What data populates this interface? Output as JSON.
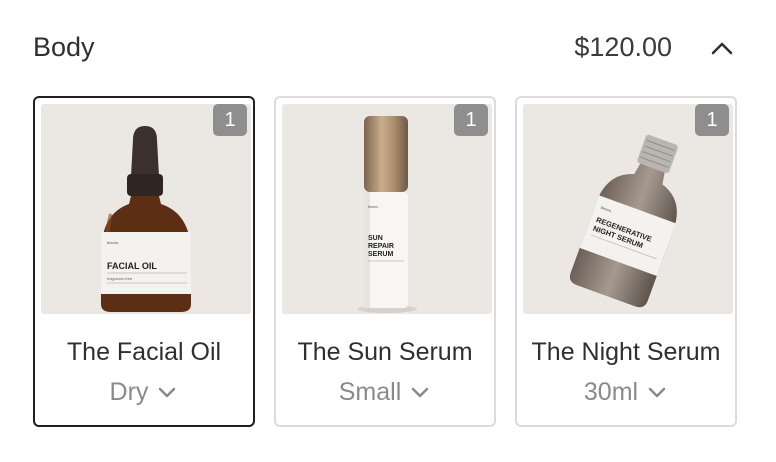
{
  "section": {
    "title": "Body",
    "subtotal": "$120.00",
    "toggle_icon": "chevron-up-icon"
  },
  "products": [
    {
      "name": "The Facial Oil",
      "variant": "Dry",
      "quantity": "1",
      "selected": true,
      "label": "FACIAL OIL"
    },
    {
      "name": "The Sun Serum",
      "variant": "Small",
      "quantity": "1",
      "selected": false,
      "label": "SUN REPAIR SERUM"
    },
    {
      "name": "The Night Serum",
      "variant": "30ml",
      "quantity": "1",
      "selected": false,
      "label": "REGENERATIVE NIGHT SERUM"
    }
  ]
}
